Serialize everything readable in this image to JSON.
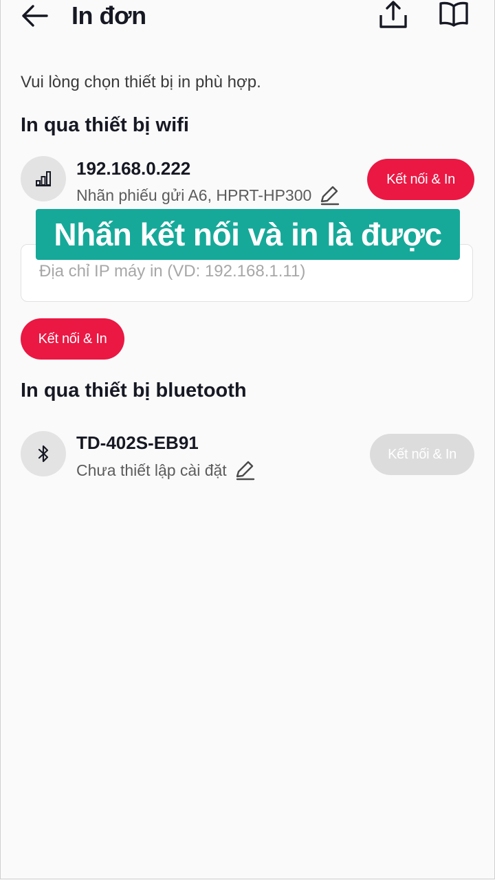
{
  "header": {
    "title": "In đơn",
    "back_icon": "arrow-left-icon",
    "share_icon": "share-upload-icon",
    "guide_icon": "open-book-icon"
  },
  "subtitle": "Vui lòng chọn thiết bị in phù hợp.",
  "wifi_section": {
    "title": "In qua thiết bị wifi",
    "device": {
      "name": "192.168.0.222",
      "description": "Nhãn phiếu gửi A6, HPRT-HP300",
      "icon": "signal-bars-icon",
      "button": "Kết nối & In"
    },
    "ip_placeholder": "Địa chỉ IP máy in (VD: 192.168.1.11)",
    "manual_button": "Kết nối & In"
  },
  "overlay_caption": "Nhấn kết nối và in là được",
  "bluetooth_section": {
    "title": "In qua thiết bị bluetooth",
    "device": {
      "name": "TD-402S-EB91",
      "description": "Chưa thiết lập cài đặt",
      "icon": "bluetooth-icon",
      "button": "Kết nối & In",
      "button_enabled": false
    }
  },
  "colors": {
    "accent": "#ea1843",
    "caption_bg": "#16a999",
    "disabled": "#dcdcdc"
  }
}
